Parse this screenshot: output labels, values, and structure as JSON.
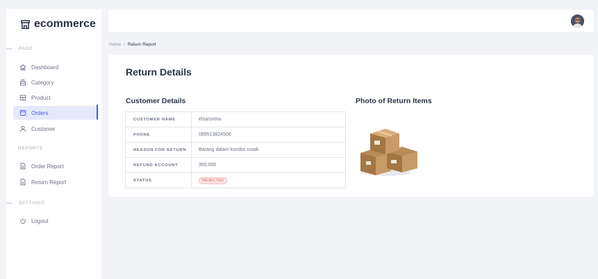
{
  "brand": {
    "name": "ecommerce"
  },
  "sidebar": {
    "sections": [
      {
        "label": "PAGE"
      },
      {
        "label": "REPORTS"
      },
      {
        "label": "SETTINGS"
      }
    ],
    "items": [
      {
        "label": "Dashboard",
        "icon": "home-icon"
      },
      {
        "label": "Category",
        "icon": "category-icon"
      },
      {
        "label": "Product",
        "icon": "product-icon"
      },
      {
        "label": "Orders",
        "icon": "orders-icon",
        "active": true
      },
      {
        "label": "Customer",
        "icon": "user-icon"
      },
      {
        "label": "Order Report",
        "icon": "document-icon"
      },
      {
        "label": "Return Report",
        "icon": "document-icon"
      },
      {
        "label": "Logout",
        "icon": "power-icon"
      }
    ]
  },
  "breadcrumb": {
    "home": "Home",
    "separator": "/",
    "current": "Return Report"
  },
  "card": {
    "title": "Return Details",
    "customer_heading": "Customer Details",
    "photo_heading": "Photo of Return Items",
    "rows": [
      {
        "key": "CUSTOMER NAME",
        "value": "elsarsntna"
      },
      {
        "key": "PHONE",
        "value": "089513824506"
      },
      {
        "key": "REASON FOR RETURN",
        "value": "Barang dalam kondisi rusak"
      },
      {
        "key": "REFUND ACCOUNT",
        "value": "350,000"
      },
      {
        "key": "STATUS",
        "value": "REJECTED"
      }
    ]
  },
  "colors": {
    "accent": "#4b5de4",
    "rejected": "#e05a62",
    "background": "#f3f4f8"
  }
}
